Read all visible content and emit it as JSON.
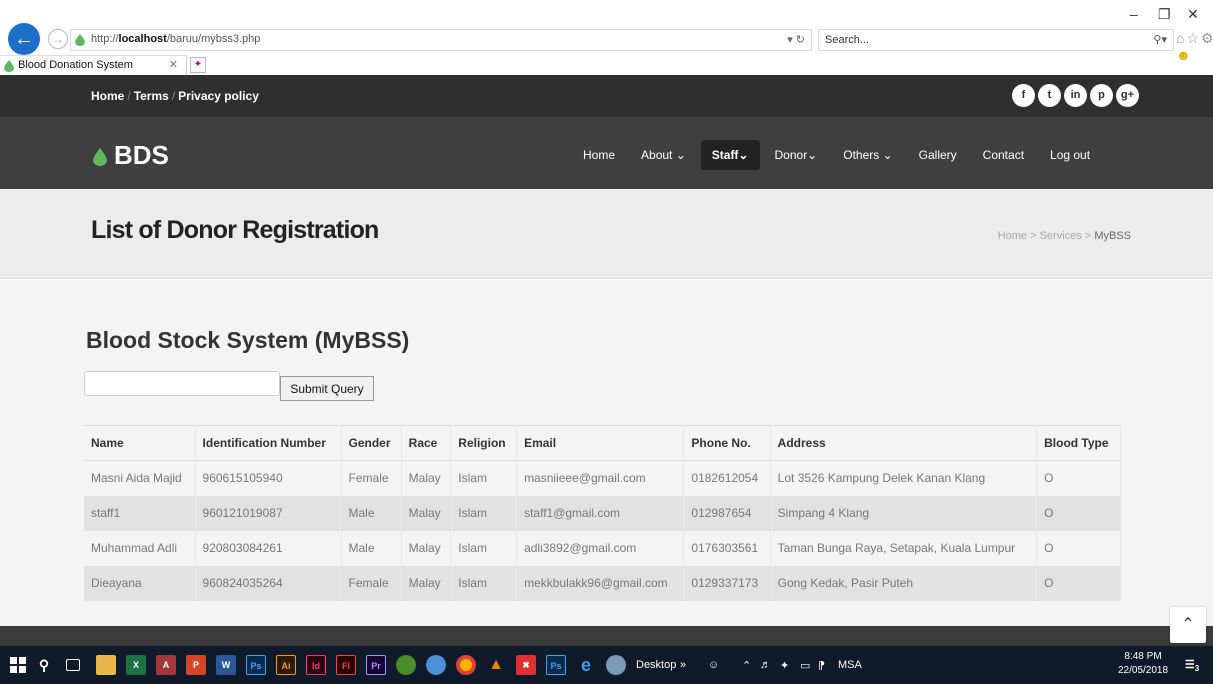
{
  "browser": {
    "url_prefix": "http://",
    "url_host": "localhost",
    "url_path": "/baruu/mybss3.php",
    "search_placeholder": "Search...",
    "tab_title": "Blood Donation System"
  },
  "topbar": {
    "links": [
      "Home",
      "Terms",
      "Privacy policy"
    ],
    "social": [
      "f",
      "t",
      "in",
      "p",
      "g+"
    ]
  },
  "header": {
    "logo": "BDS",
    "nav": [
      {
        "label": "Home",
        "active": false
      },
      {
        "label": "About ⌄",
        "active": false
      },
      {
        "label": "Staff⌄",
        "active": true
      },
      {
        "label": "Donor⌄",
        "active": false
      },
      {
        "label": "Others ⌄",
        "active": false
      },
      {
        "label": "Gallery",
        "active": false
      },
      {
        "label": "Contact",
        "active": false
      },
      {
        "label": "Log out",
        "active": false
      }
    ]
  },
  "title_band": {
    "title": "List of Donor Registration",
    "breadcrumb": [
      "Home",
      "Services",
      "MyBSS"
    ]
  },
  "content": {
    "section_title": "Blood Stock System (MyBSS)",
    "submit_label": "Submit Query",
    "columns": [
      "Name",
      "Identification Number",
      "Gender",
      "Race",
      "Religion",
      "Email",
      "Phone No.",
      "Address",
      "Blood Type"
    ],
    "rows": [
      [
        "Masni Aida Majid",
        "960615105940",
        "Female",
        "Malay",
        "Islam",
        "masniieee@gmail.com",
        "0182612054",
        "Lot 3526 Kampung Delek Kanan Klang",
        "O"
      ],
      [
        "staff1",
        "960121019087",
        "Male",
        "Malay",
        "Islam",
        "staff1@gmail.com",
        "012987654",
        "Simpang 4 Klang",
        "O"
      ],
      [
        "Muhammad Adli",
        "920803084261",
        "Male",
        "Malay",
        "Islam",
        "adli3892@gmail.com",
        "0176303561",
        "Taman Bunga Raya, Setapak, Kuala Lumpur",
        "O"
      ],
      [
        "Dieayana",
        "960824035264",
        "Female",
        "Malay",
        "Islam",
        "mekkbulakk96@gmail.com",
        "0129337173",
        "Gong Kedak, Pasir Puteh",
        "O"
      ]
    ]
  },
  "taskbar": {
    "desktop_label": "Desktop",
    "lang": "MSA",
    "time": "8:48 PM",
    "date": "22/05/2018",
    "notification_count": "3"
  },
  "colors": {
    "topbar": "#2f2f2f",
    "header": "#3f3f3f",
    "logo_drop": "#5db85c",
    "ie_back": "#1c6fc9"
  }
}
